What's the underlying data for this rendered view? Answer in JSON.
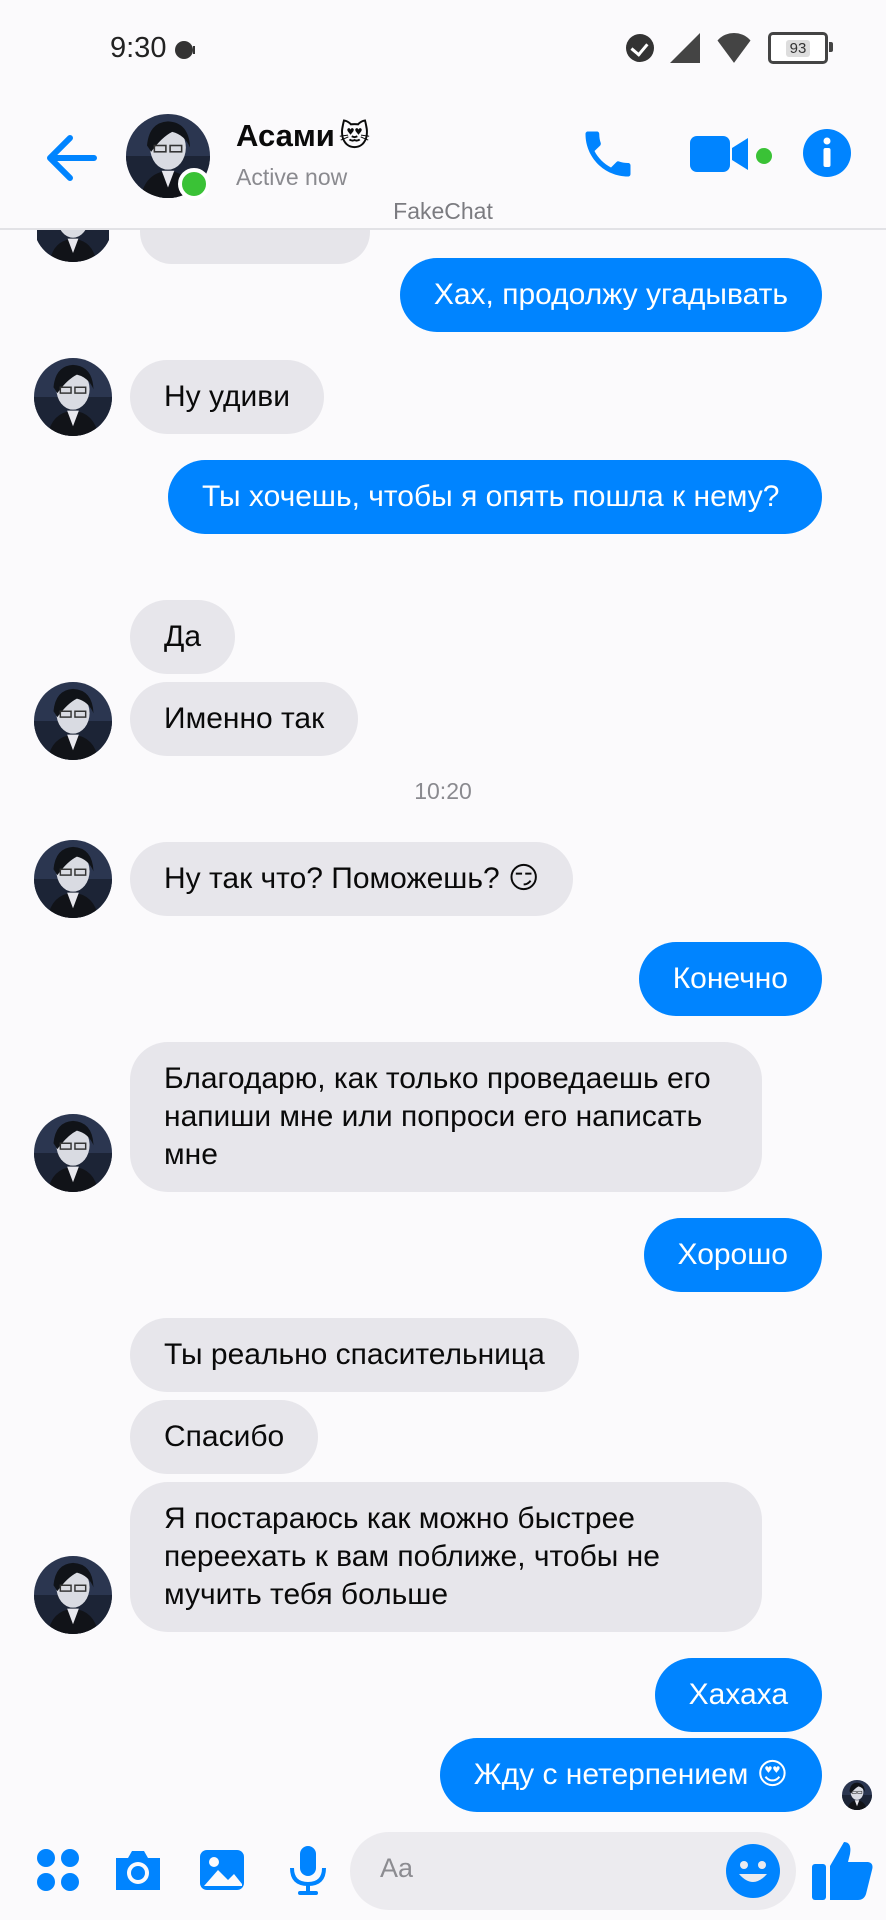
{
  "status_bar": {
    "time": "9:30",
    "battery": "93"
  },
  "header": {
    "contact_name": "Асами",
    "name_emoji": "😻",
    "status": "Active now",
    "watermark": "FakeChat"
  },
  "colors": {
    "accent": "#0084ff",
    "received_bubble": "#e7e6eb",
    "online": "#3ac236"
  },
  "messages": [
    {
      "from": "me",
      "text": "Хах, продолжу угадывать"
    },
    {
      "from": "them",
      "text": "Ну удиви"
    },
    {
      "from": "me",
      "text": "Ты хочешь, чтобы я опять пошла к нему?"
    },
    {
      "from": "them",
      "text": "Да"
    },
    {
      "from": "them",
      "text": "Именно так"
    },
    {
      "from": "them",
      "text": "Ну так что? Поможешь?",
      "emoji": "😏"
    },
    {
      "from": "me",
      "text": "Конечно"
    },
    {
      "from": "them",
      "text": "Благодарю, как только проведаешь его напиши мне или попроси его написать мне"
    },
    {
      "from": "me",
      "text": "Хорошо"
    },
    {
      "from": "them",
      "text": "Ты реально спасительница"
    },
    {
      "from": "them",
      "text": "Спасибо"
    },
    {
      "from": "them",
      "text": "Я постараюсь как можно быстрее переехать к вам поближе, чтобы не мучить тебя больше"
    },
    {
      "from": "me",
      "text": "Хахаха"
    },
    {
      "from": "me",
      "text": "Жду с нетерпением",
      "emoji": "😍"
    }
  ],
  "timestamp": "10:20",
  "composer": {
    "placeholder": "Aa"
  },
  "icons": [
    "back-arrow-icon",
    "phone-icon",
    "video-camera-icon",
    "info-icon",
    "apps-icon",
    "camera-icon",
    "gallery-icon",
    "microphone-icon",
    "emoji-icon",
    "thumbs-up-icon"
  ]
}
